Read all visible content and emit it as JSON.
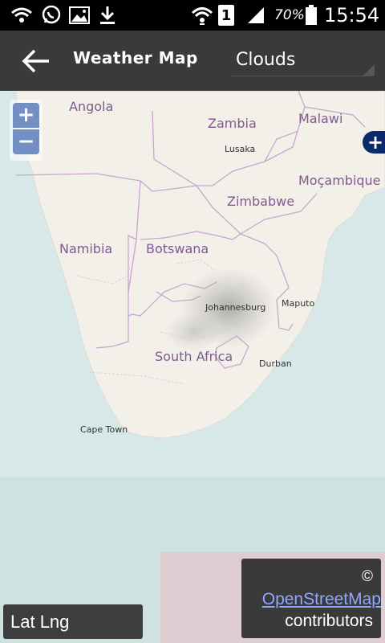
{
  "status_bar": {
    "battery": "70%",
    "time": "15:54",
    "sim": "1"
  },
  "action_bar": {
    "title": "Weather Map",
    "layer_selected": "Clouds"
  },
  "map": {
    "countries": [
      "Angola",
      "Zambia",
      "Malawi",
      "Moçambique",
      "Zimbabwe",
      "Namibia",
      "Botswana",
      "South Africa"
    ],
    "cities": [
      "Lusaka",
      "Johannesburg",
      "Maputo",
      "Durban",
      "Cape Town"
    ],
    "zoom_in_label": "+",
    "zoom_out_label": "−",
    "layer_switch_label": "+"
  },
  "latlng": {
    "label": "Lat Lng"
  },
  "attribution": {
    "copyright": "©",
    "link": "OpenStreetMap",
    "suffix": "contributors"
  },
  "colors": {
    "action_bar": "#3a3a3a",
    "land": "#f2efe9",
    "sea": "#d6e8e8",
    "border": "#c8a5cf",
    "zoom": "#5d7fbb",
    "link": "#8da9ff"
  }
}
